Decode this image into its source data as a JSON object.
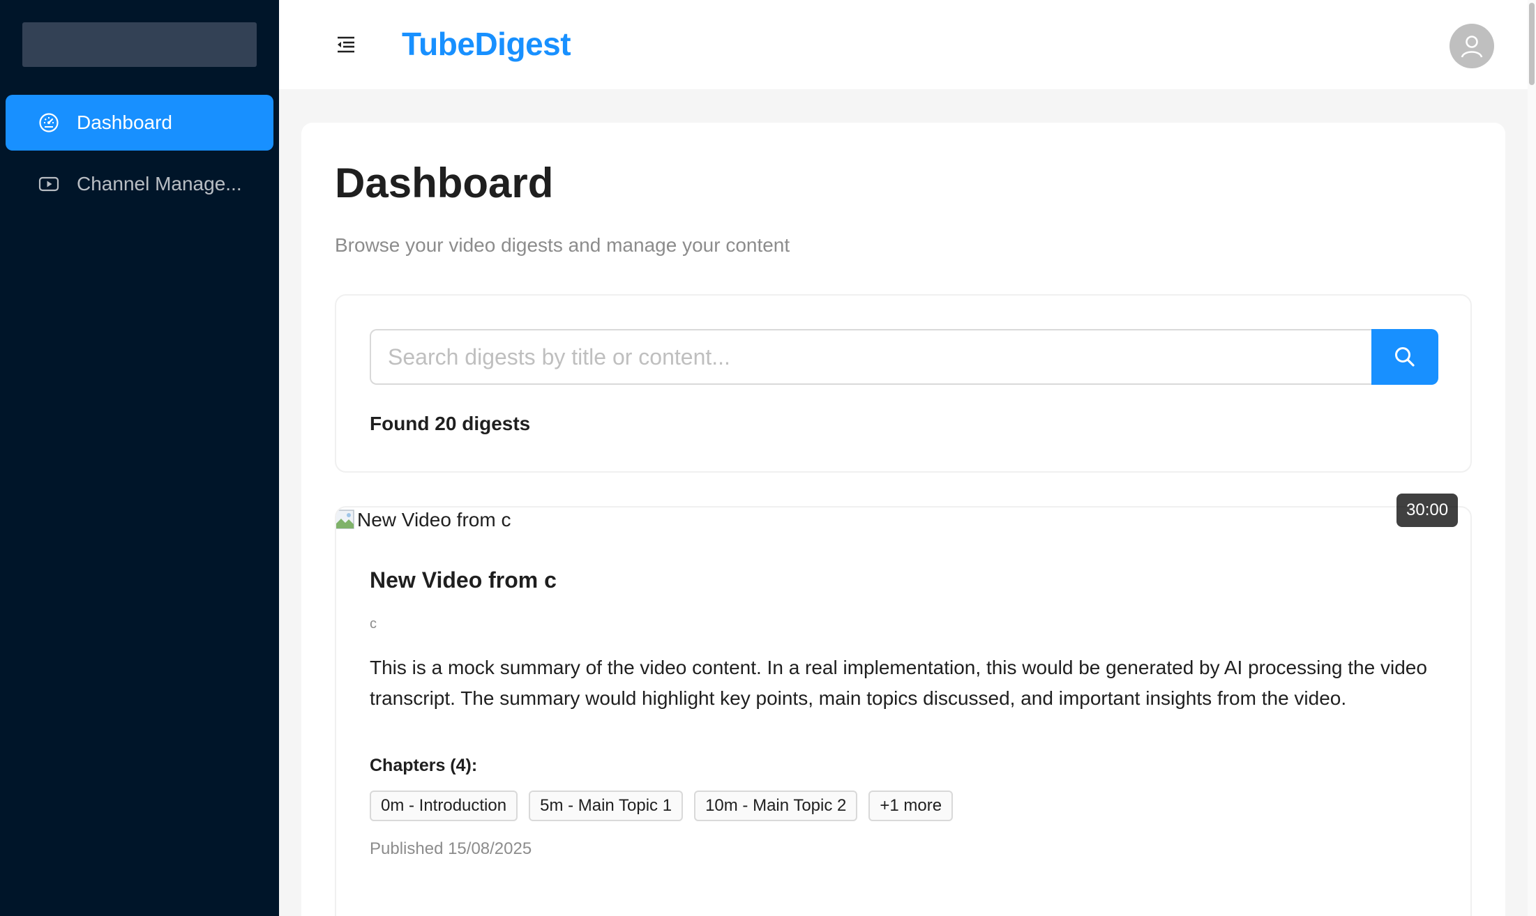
{
  "app": {
    "brand": "TubeDigest"
  },
  "sidebar": {
    "items": [
      {
        "label": "Dashboard",
        "icon": "dashboard-icon",
        "active": true
      },
      {
        "label": "Channel Manage...",
        "icon": "youtube-icon",
        "active": false
      }
    ]
  },
  "main": {
    "title": "Dashboard",
    "subtitle": "Browse your video digests and manage your content",
    "search": {
      "placeholder": "Search digests by title or content...",
      "value": ""
    },
    "found_text": "Found 20 digests"
  },
  "digests": [
    {
      "thumbnail_alt": "New Video from c",
      "duration": "30:00",
      "title": "New Video from c",
      "channel": "c",
      "summary": "This is a mock summary of the video content. In a real implementation, this would be generated by AI processing the video transcript. The summary would highlight key points, main topics discussed, and important insights from the video.",
      "chapters_label": "Chapters (4):",
      "chapters": [
        "0m - Introduction",
        "5m - Main Topic 1",
        "10m - Main Topic 2",
        "+1 more"
      ],
      "published": "Published 15/08/2025"
    }
  ],
  "colors": {
    "primary": "#1890ff",
    "sidebar_bg": "#001529",
    "page_bg": "#f5f5f5"
  }
}
